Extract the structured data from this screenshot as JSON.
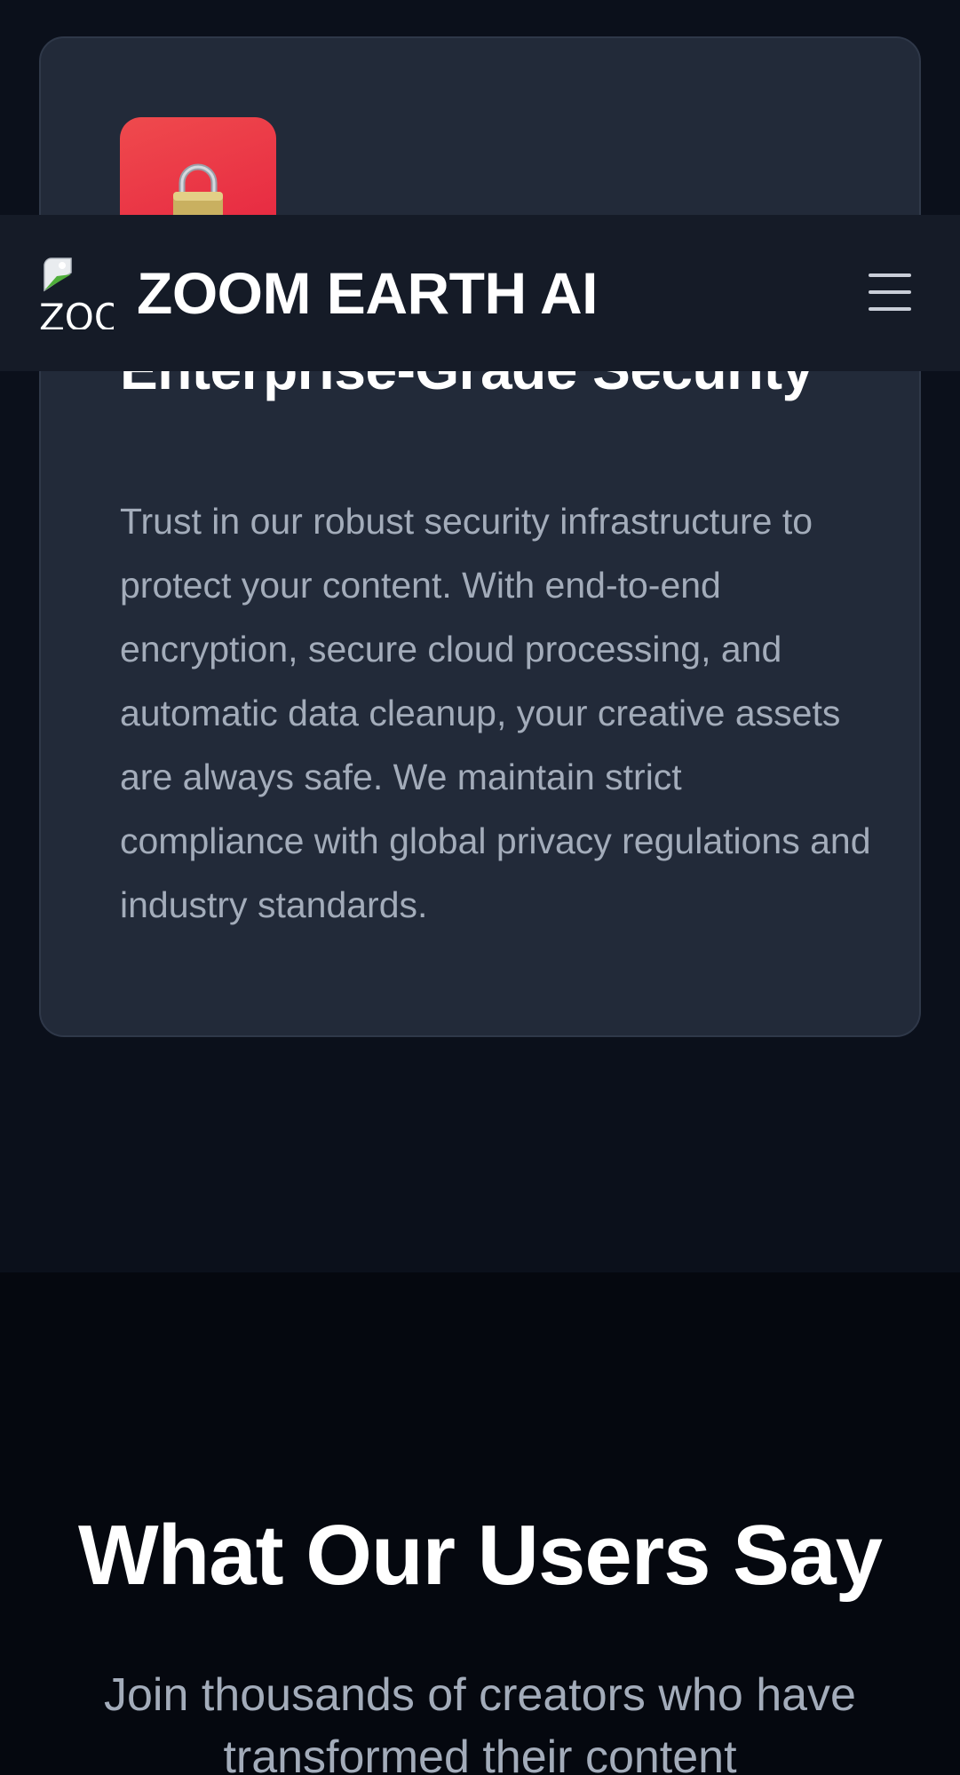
{
  "header": {
    "logo_alt": "ZOO",
    "brand": "ZOOM EARTH AI",
    "menu_icon": "hamburger-menu-icon"
  },
  "feature": {
    "icon": "lock-icon",
    "title": "Enterprise-Grade Security",
    "description": "Trust in our robust security infrastructure to protect your content. With end-to-end encryption, secure cloud processing, and automatic data cleanup, your creative assets are always safe. We maintain strict compliance with global privacy regulations and industry standards."
  },
  "testimonials": {
    "title": "What Our Users Say",
    "subtitle": "Join thousands of creators who have transformed their content"
  },
  "colors": {
    "card_bg": "#222a39",
    "icon_gradient_start": "#ef4a4d",
    "icon_gradient_end": "#e5203e",
    "header_bg": "#151b27",
    "page_bg": "#0b101b"
  }
}
